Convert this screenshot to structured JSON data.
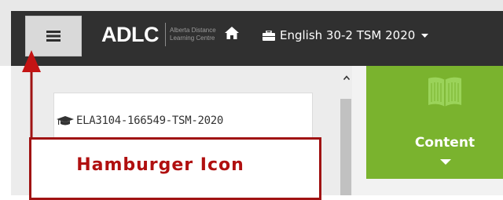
{
  "header": {
    "logo_text": "ADLC",
    "logo_subtitle": "Alberta Distance Learning Centre",
    "course_selector": "English 30-2 TSM 2020",
    "icons": [
      "hamburger-icon",
      "home-icon",
      "briefcase-icon",
      "caret-down-icon"
    ]
  },
  "course": {
    "code": "ELA3104-166549-TSM-2020",
    "icon": "graduation-cap-icon"
  },
  "content_panel": {
    "label": "Content",
    "icon": "book-icon"
  },
  "annotation": {
    "label": "Hamburger Icon",
    "color": "#b01010"
  },
  "colors": {
    "topbar": "#303030",
    "content_green": "#7ab32e",
    "annotation_red": "#a01313"
  }
}
